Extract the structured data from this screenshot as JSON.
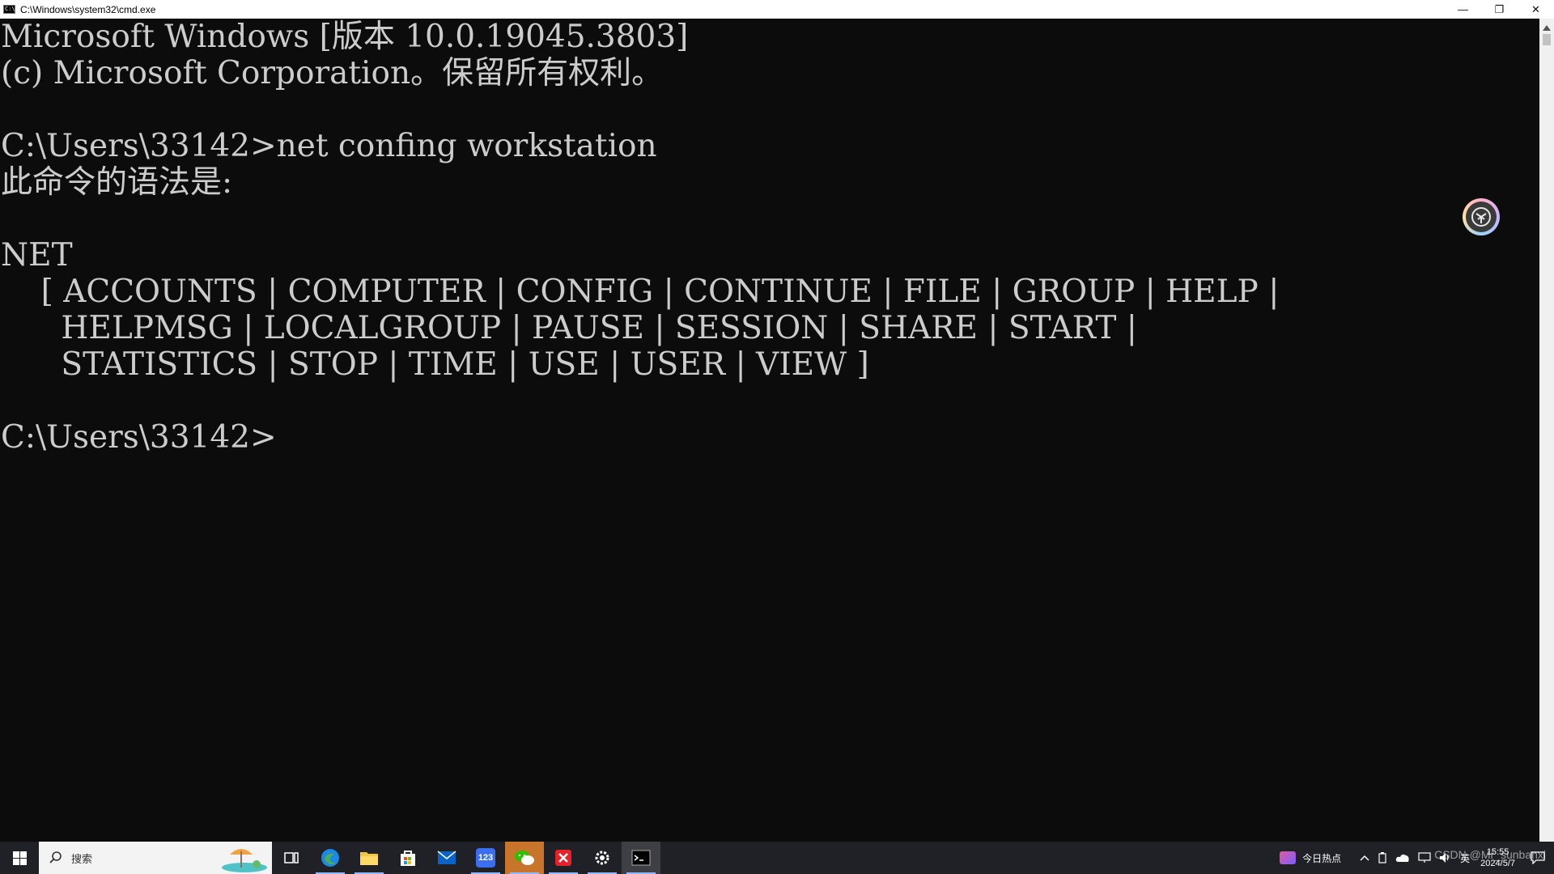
{
  "window": {
    "title": "C:\\Windows\\system32\\cmd.exe",
    "icon_text": "C:\\",
    "minimize_glyph": "—",
    "restore_glyph": "❐",
    "close_glyph": "✕"
  },
  "console": {
    "lines": [
      "Microsoft Windows [版本 10.0.19045.3803]",
      "(c) Microsoft Corporation。保留所有权利。",
      "",
      "C:\\Users\\33142>net confing workstation",
      "此命令的语法是:",
      "",
      "NET",
      "    [ ACCOUNTS | COMPUTER | CONFIG | CONTINUE | FILE | GROUP | HELP |",
      "      HELPMSG | LOCALGROUP | PAUSE | SESSION | SHARE | START |",
      "      STATISTICS | STOP | TIME | USE | USER | VIEW ]",
      "",
      "C:\\Users\\33142>"
    ],
    "background": "#0c0c0c",
    "foreground": "#cccccc"
  },
  "taskbar": {
    "search_placeholder": "搜索",
    "pinned": [
      {
        "name": "task-view-icon",
        "label": ""
      },
      {
        "name": "edge-icon",
        "label": ""
      },
      {
        "name": "file-explorer-icon",
        "label": ""
      },
      {
        "name": "store-icon",
        "label": ""
      },
      {
        "name": "mail-icon",
        "label": ""
      },
      {
        "name": "app-123-icon",
        "label": "123"
      },
      {
        "name": "wechat-icon",
        "label": ""
      },
      {
        "name": "xmind-icon",
        "label": ""
      },
      {
        "name": "settings-icon",
        "label": ""
      },
      {
        "name": "terminal-icon",
        "label": ""
      }
    ],
    "news_label": "今日热点",
    "tray_lang": "英",
    "clock_time": "15:55",
    "clock_date": "2024/5/7",
    "watermark": "CSDN @Mr_sunbanxi"
  }
}
